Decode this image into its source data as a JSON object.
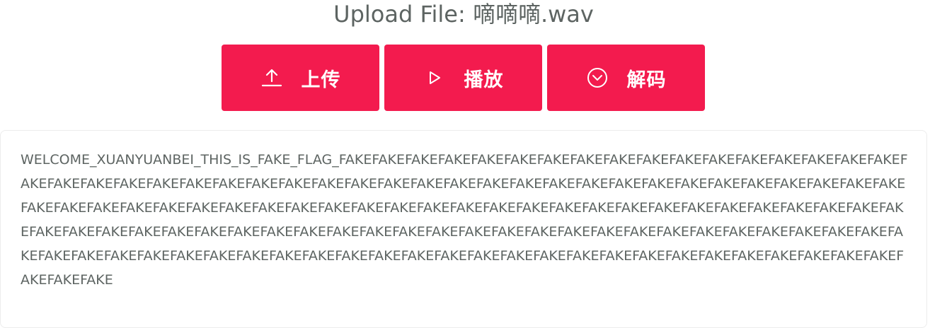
{
  "header": {
    "title": "Upload File: 嘀嘀嘀.wav"
  },
  "toolbar": {
    "upload_label": "上传",
    "play_label": "播放",
    "decode_label": "解码",
    "upload_icon": "upload-icon",
    "play_icon": "play-icon",
    "decode_icon": "chevron-down-circle-icon"
  },
  "result": {
    "text": "WELCOME_XUANYUANBEI_THIS_IS_FAKE_FLAG_FAKEFAKEFAKEFAKEFAKEFAKEFAKEFAKEFAKEFAKEFAKEFAKEFAKEFAKEFAKEFAKEFAKEFAKEFAKEFAKEFAKEFAKEFAKEFAKEFAKEFAKEFAKEFAKEFAKEFAKEFAKEFAKEFAKEFAKEFAKEFAKEFAKEFAKEFAKEFAKEFAKEFAKEFAKEFAKEFAKEFAKEFAKEFAKEFAKEFAKEFAKEFAKEFAKEFAKEFAKEFAKEFAKEFAKEFAKEFAKEFAKEFAKEFAKEFAKEFAKEFAKEFAKEFAKEFAKEFAKEFAKEFAKEFAKEFAKEFAKEFAKEFAKEFAKEFAKEFAKEFAKEFAKEFAKEFAKEFAKEFAKEFAKEFAKEFAKEFAKEFAKEFAKEFAKEFAKEFAKEFAKEFAKEFAKEFAKEFAKEFAKEFAKEFAKEFAKEFAKEFAKEFAKEFAKEFAKEFAKEFAKEFAKEFAKEFAKEFAKEFAKEFAKEFAKEFAKEFAKEFAKEFAKEFAKEFAKEFAKEFAKEFAKE"
  },
  "colors": {
    "accent": "#f31b4e",
    "text": "#5d6462",
    "card_border": "#ececec"
  }
}
